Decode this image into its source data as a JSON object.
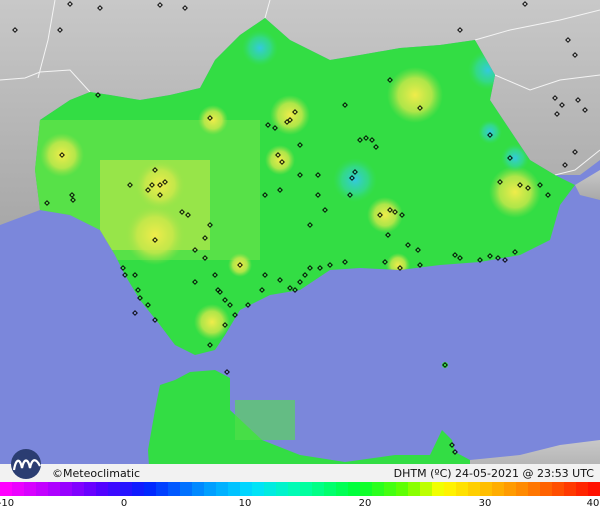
{
  "brand": {
    "logo_icon": "meteoclimatic-logo-icon",
    "name": "©Meteoclimatic"
  },
  "legend": {
    "variable": "DHTM (ºC)",
    "date": "24-05-2021",
    "separator": "@",
    "time": "23:53 UTC",
    "ticks": [
      "-10",
      "0",
      "10",
      "20",
      "30",
      "40"
    ],
    "scale_min": -10,
    "scale_max": 40
  },
  "colors": {
    "sea": "#7b87db",
    "land_outside": "#b8b8b8",
    "field_base": "#33dd44",
    "warm": "#e8e84a",
    "cool": "#33ccdd",
    "station": "#000000"
  }
}
